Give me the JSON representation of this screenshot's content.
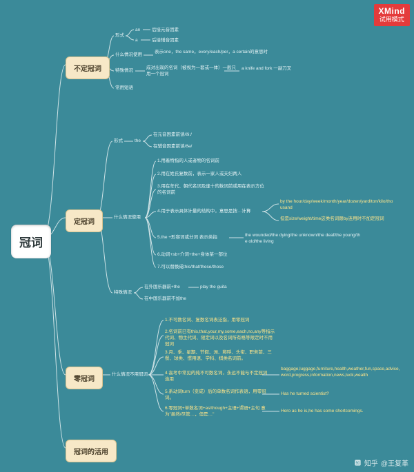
{
  "meta": {
    "brand": "XMind",
    "mode": "试用模式",
    "credit_platform": "知乎",
    "credit_author": "@王复革"
  },
  "root": {
    "label": "冠词"
  },
  "branches": {
    "indef": {
      "label": "不定冠词",
      "form": {
        "label": "形式",
        "an": "an",
        "an_desc": "后接元音因素",
        "a": "a",
        "a_desc": "后接辅音因素"
      },
      "when": {
        "label": "什么情况使用",
        "desc": "表示one，the same，every/each/per，a certain的意思时"
      },
      "special": {
        "label": "特殊情况",
        "desc": "成对出现的名词（被视为一套或一体）一般只用一个冠词",
        "example": "a knife and fork 一副刀叉"
      },
      "phrases": {
        "label": "常用短语"
      }
    },
    "def": {
      "label": "定冠词",
      "form": {
        "label": "形式",
        "the": "the",
        "vowel": "在元音因素前读/ði:/",
        "cons": "在辅音因素前读/ðə/"
      },
      "when": {
        "label": "什么情况使用",
        "r1": "1.用着特指的人或者物的名词前",
        "r2": "2.用在姓氏复数前，表示一家人或夫妇两人",
        "r3": "3.用在年代、朝代名词及逢十的数词前或用在表示方位的名词前",
        "r4": "4.用于表示具体计量的结构中，意思是按…计算",
        "r4_a": "by the hour/day/week/month/year/dozen/yard/ton/kilo/thousand",
        "r4_b": "但是size/weight/time这类名词跟by连用时不加定冠词",
        "r5": "5.the +形容词或分词  表示类指",
        "r5_a": "the wounded/the dying/the unknown/the deaf/the young/the old/the living",
        "r6": "6.动词+sb+介词+the+身体某一部位",
        "r7": "7.可以替换成this/that/these/those"
      },
      "special": {
        "label": "特殊情况",
        "a": "在外国乐器前+the",
        "a_ex": "play the guita",
        "b": "在中国乐器前不加the"
      }
    },
    "zero": {
      "label": "零冠词",
      "when": {
        "label": "什么情况不用冠词",
        "r1": "1.不可数名词、复数名词表泛指，用零冠词",
        "r2": "2.名词前已有this,that,your,my,some,each,no,any等指示代词、物主代词、限定词以及名词所有格等限定时不用冠词",
        "r3": "3.月、季、星期、节假、洲、称呼、头衔、职务前、三餐、球类、惯用语、学科、棋类名词前。",
        "r4": "4.高考中常见的纯不可数名词，永远不能与不定冠词连用",
        "r4_a": "baggage,luggage,furniture,health,weather,fun,space,advice,word,progress,information,news,luck,wealth",
        "r5": "5.系动词turn（变成）后的单数名词作表语，用零冠词。",
        "r5_a": "Has he turned scientist?",
        "r6": "6.零冠词+单数名词+as/though+主语+谓语+主句  意为\"虽然/尽管…，但是…\"",
        "r6_a": "Hero as he is,he has some shortcomings."
      }
    },
    "flex": {
      "label": "冠词的活用"
    }
  }
}
